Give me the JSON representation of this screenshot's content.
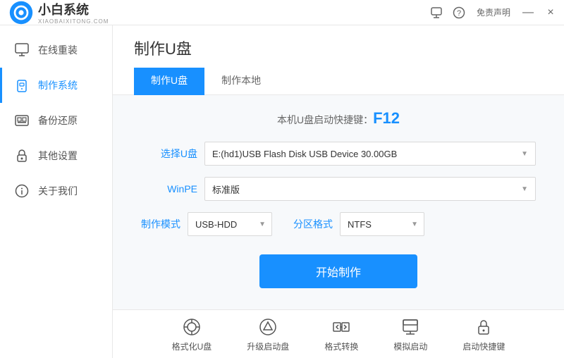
{
  "titlebar": {
    "logo_main": "小白系统",
    "logo_sub": "XIAOBAIXITONG.COM",
    "free_label": "免责声明",
    "minimize_label": "—",
    "close_label": "×"
  },
  "sidebar": {
    "items": [
      {
        "id": "online-reinstall",
        "label": "在线重装",
        "icon": "🖥"
      },
      {
        "id": "make-system",
        "label": "制作系统",
        "icon": "💾"
      },
      {
        "id": "backup-restore",
        "label": "备份还原",
        "icon": "🗂"
      },
      {
        "id": "other-settings",
        "label": "其他设置",
        "icon": "🔒"
      },
      {
        "id": "about-us",
        "label": "关于我们",
        "icon": "ℹ"
      }
    ]
  },
  "page": {
    "title": "制作U盘",
    "tabs": [
      {
        "id": "make-usb",
        "label": "制作U盘",
        "active": true
      },
      {
        "id": "make-local",
        "label": "制作本地",
        "active": false
      }
    ],
    "shortcut_prefix": "本机U盘启动快捷键：",
    "shortcut_key": "F12",
    "form": {
      "usb_label": "选择U盘",
      "usb_value": "E:(hd1)USB Flash Disk USB Device 30.00GB",
      "winpe_label": "WinPE",
      "winpe_value": "标准版",
      "mode_label": "制作模式",
      "mode_value": "USB-HDD",
      "partition_label": "分区格式",
      "partition_value": "NTFS"
    },
    "start_button": "开始制作"
  },
  "bottom_toolbar": {
    "tools": [
      {
        "id": "format-usb",
        "label": "格式化U盘",
        "icon": "⊙"
      },
      {
        "id": "upgrade-boot",
        "label": "升级启动盘",
        "icon": "⊕"
      },
      {
        "id": "format-convert",
        "label": "格式转换",
        "icon": "⇄"
      },
      {
        "id": "simulate-boot",
        "label": "模拟启动",
        "icon": "⊞"
      },
      {
        "id": "boot-shortcut",
        "label": "启动快捷键",
        "icon": "🔒"
      }
    ]
  }
}
